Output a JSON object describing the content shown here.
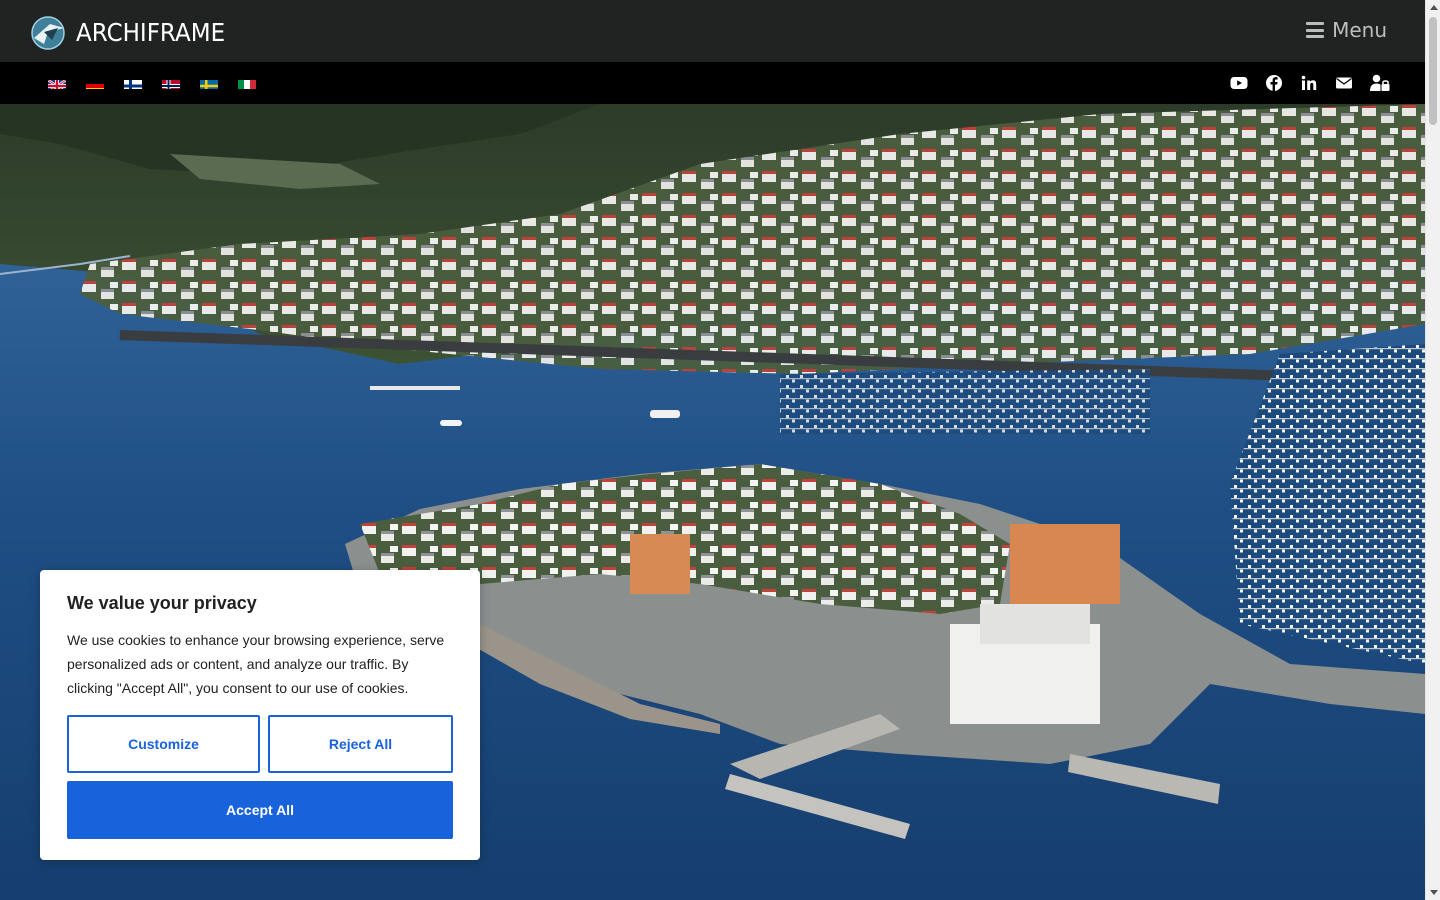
{
  "header": {
    "brand": "ARCHIFRAME",
    "menu_label": "Menu"
  },
  "languages": [
    {
      "code": "en",
      "icon": "uk-flag-icon"
    },
    {
      "code": "de",
      "icon": "germany-flag-icon"
    },
    {
      "code": "fi",
      "icon": "finland-flag-icon"
    },
    {
      "code": "no",
      "icon": "norway-flag-icon"
    },
    {
      "code": "sv",
      "icon": "sweden-flag-icon"
    },
    {
      "code": "it",
      "icon": "italy-flag-icon"
    }
  ],
  "social": [
    "youtube-icon",
    "facebook-icon",
    "linkedin-icon",
    "email-icon",
    "user-lock-icon"
  ],
  "hero": {
    "image": "aerial-harbor-town-photo"
  },
  "cookie": {
    "title": "We value your privacy",
    "text": "We use cookies to enhance your browsing experience, serve personalized ads or content, and analyze our traffic. By clicking \"Accept All\", you consent to our use of cookies.",
    "customize_label": "Customize",
    "reject_label": "Reject All",
    "accept_label": "Accept All"
  },
  "colors": {
    "header_bg": "#212322",
    "subbar_bg": "#000000",
    "accent": "#1863dc"
  }
}
